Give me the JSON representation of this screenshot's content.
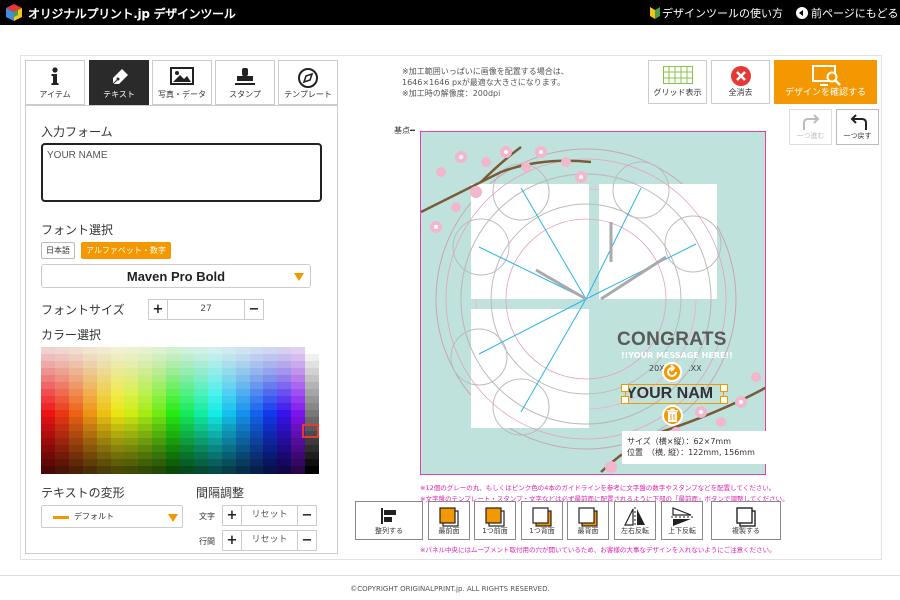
{
  "header": {
    "title": "オリジナルプリント.jp デザインツール",
    "guide_link": "デザインツールの使い方",
    "back_link": "前ページにもどる"
  },
  "tabs": [
    {
      "label": "アイテム",
      "icon": "info-icon"
    },
    {
      "label": "テキスト",
      "icon": "pen-icon",
      "active": true
    },
    {
      "label": "写真・データ",
      "icon": "image-icon"
    },
    {
      "label": "スタンプ",
      "icon": "stamp-icon"
    },
    {
      "label": "テンプレート",
      "icon": "compass-icon"
    }
  ],
  "form": {
    "input_label": "入力フォーム",
    "input_value": "YOUR NAME",
    "font_label": "フォント選択",
    "font_category_jp": "日本語",
    "font_category_alpha": "アルファベット・数字",
    "font_value": "Maven Pro Bold",
    "size_label": "フォントサイズ",
    "size_value": "27",
    "plus": "+",
    "minus": "−",
    "color_label": "カラー選択",
    "transform_label": "テキストの変形",
    "transform_value": "デフォルト",
    "spacing_label": "間隔調整",
    "char_label": "文字",
    "line_label": "行間",
    "reset": "リセット"
  },
  "toolbar": {
    "notice_line1": "※加工範囲いっぱいに画像を配置する場合は、",
    "notice_line2": "1646×1646 pxが最適な大きさになります。",
    "notice_line3": "※加工時の解像度：200dpi",
    "grid_label": "グリッド表示",
    "clear_label": "全消去",
    "confirm_label": "デザインを確認する",
    "redo_label": "一つ進む",
    "undo_label": "一つ戻す"
  },
  "canvas": {
    "origin_label": "基点",
    "congrats": "CONGRATS",
    "message": "!!YOUR MESSAGE HERE!!",
    "date_left": "20XX",
    "date_right": ".XX",
    "your_name": "YOUR NAM",
    "size_line1": "サイズ（横×縦）：62×7mm",
    "size_line2": "位置　（横, 縦）：122mm, 156mm",
    "colors": {
      "background": "#bfe3dc",
      "border": "#e040b0",
      "accent": "#f39800"
    }
  },
  "notes": {
    "note1": "※12個のグレーの丸、もしくはピンク色の4本のガイドラインを参考に文字盤の数字やスタンプなどを配置してください。",
    "note2": "※文字盤のテンプレート・スタンプ・文字などは必ず最前面に配置されるように下部の「最前面」ボタンで調整してください。",
    "note3": "※パネル中央にはムーブメント取付用の穴が開いているため、お客様の大事なデザインを入れないようにご注意ください。"
  },
  "align_tools": [
    {
      "label": "整列する"
    },
    {
      "label": "最前面"
    },
    {
      "label": "1つ前面"
    },
    {
      "label": "1つ背面"
    },
    {
      "label": "最背面"
    },
    {
      "label": "左右反転"
    },
    {
      "label": "上下反転"
    },
    {
      "label": "複製する"
    }
  ],
  "footer": "©COPYRIGHT ORIGINALPRINT.jp. ALL RIGHTS RESERVED."
}
